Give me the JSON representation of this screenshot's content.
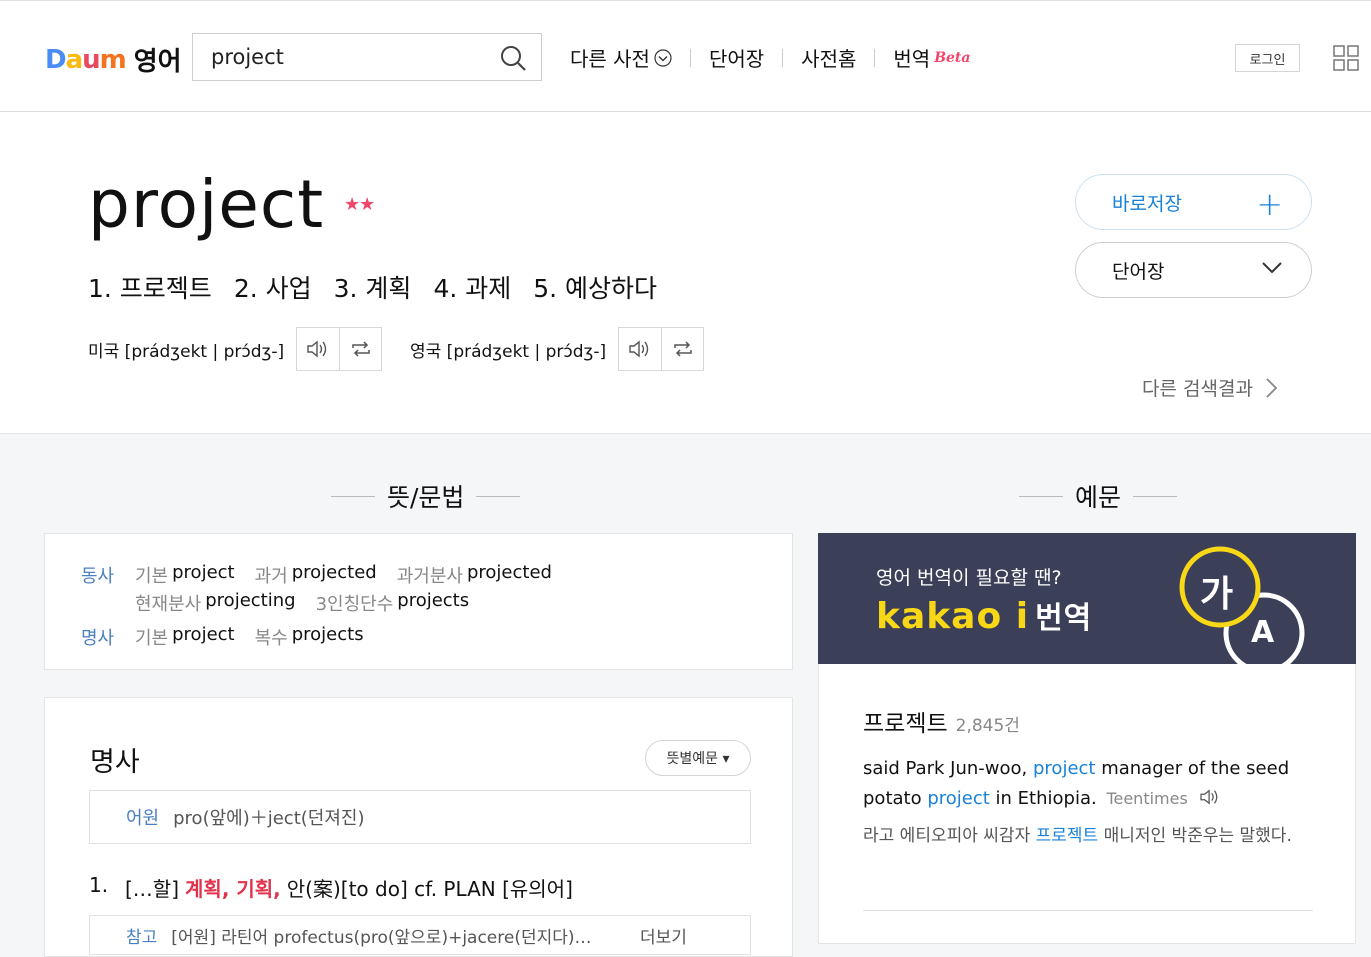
{
  "header": {
    "logo_brand": "Daum",
    "logo_title": "영어",
    "search_value": "project",
    "nav": [
      "다른 사전",
      "단어장",
      "사전홈",
      "번역"
    ],
    "beta": "Beta",
    "login": "로그인"
  },
  "word": {
    "headword": "project",
    "stars": "★★",
    "meanings": [
      "1. 프로젝트",
      "2. 사업",
      "3. 계획",
      "4. 과제",
      "5. 예상하다"
    ],
    "pron_us": "미국 [prádʒekt | prɔ́dʒ-]",
    "pron_uk": "영국 [prádʒekt | prɔ́dʒ-]",
    "save_label": "바로저장",
    "wordbook_label": "단어장",
    "other_results": "다른 검색결과"
  },
  "sections": {
    "meaning_title": "뜻/문법",
    "example_title": "예문"
  },
  "inflections": {
    "verb_pos": "동사",
    "verb_row1": [
      {
        "k": "기본",
        "v": "project"
      },
      {
        "k": "과거",
        "v": "projected"
      },
      {
        "k": "과거분사",
        "v": "projected"
      }
    ],
    "verb_row2": [
      {
        "k": "현재분사",
        "v": "projecting"
      },
      {
        "k": "3인칭단수",
        "v": "projects"
      }
    ],
    "noun_pos": "명사",
    "noun_row": [
      {
        "k": "기본",
        "v": "project"
      },
      {
        "k": "복수",
        "v": "projects"
      }
    ]
  },
  "noun_section": {
    "title": "명사",
    "example_toggle": "뜻별예문 ▾",
    "etym_label": "어원",
    "etym_text": "pro(앞에)＋ject(던져진)",
    "def1_num": "1.",
    "def1_pre": "[…할]",
    "def1_red": "계획, 기획,",
    "def1_post": "안(案)[to do] cf. PLAN [유의어]",
    "note_label": "참고",
    "note_text": "[어원] 라틴어 profectus(pro(앞으로)+jacere(던지다)…",
    "note_more": "더보기"
  },
  "banner": {
    "line1": "영어 번역이 필요할 땐?",
    "brand": "kakao i",
    "brand_word": "번역",
    "glyph1": "가",
    "glyph2": "A"
  },
  "example": {
    "word": "프로젝트",
    "count": "2,845건",
    "s_part1": "said Park Jun-woo, ",
    "s_hl1": "project",
    "s_part2": " manager of the seed potato ",
    "s_hl2": "project",
    "s_part3": " in Ethiopia.",
    "source": "Teentimes",
    "t_part1": "라고 에티오피아 씨감자 ",
    "t_hl": "프로젝트",
    "t_part2": " 매니저인 박준우는 말했다."
  }
}
